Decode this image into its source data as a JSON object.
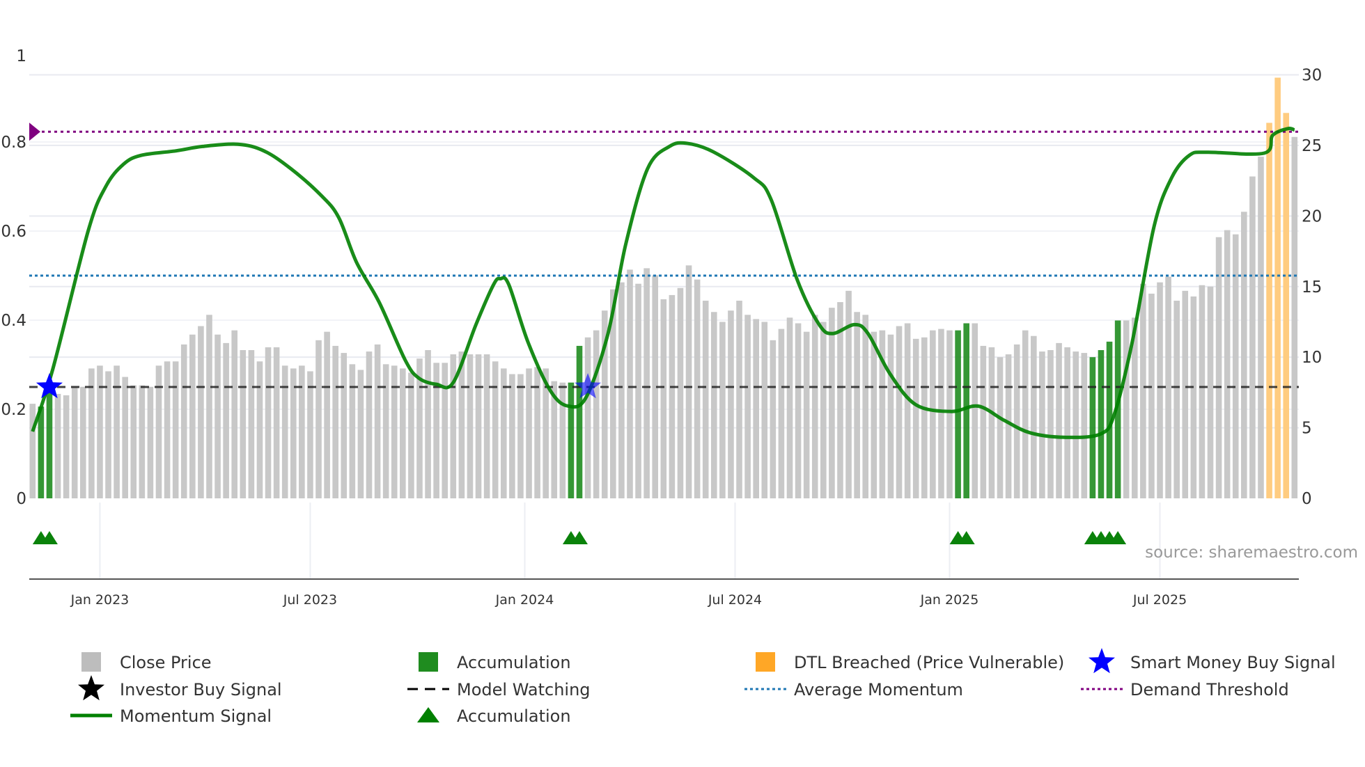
{
  "chart_data": {
    "type": "bar+line",
    "title": "",
    "left_axis": {
      "ticks": [
        "0",
        "0.2",
        "0.4",
        "0.6",
        "0.8",
        "1"
      ],
      "values": [
        0,
        0.2,
        0.4,
        0.6,
        0.8,
        1
      ],
      "range": [
        0,
        1
      ]
    },
    "right_axis": {
      "ticks": [
        "0",
        "5",
        "10",
        "15",
        "20",
        "25",
        "30"
      ],
      "values": [
        0,
        5,
        10,
        15,
        20,
        25,
        30
      ],
      "range": [
        0,
        30
      ]
    },
    "x_ticks": {
      "labels": [
        "Jan 2023",
        "Jul 2023",
        "Jan 2024",
        "Jul 2024",
        "Jan 2025",
        "Jul 2025"
      ],
      "week_index": [
        8,
        33,
        58.5,
        83.5,
        109,
        134
      ]
    },
    "close_price": [
      6.7,
      6.5,
      7.9,
      7.4,
      7.3,
      7.9,
      7.9,
      9.2,
      9.4,
      9.0,
      9.4,
      8.6,
      8.0,
      8.0,
      7.9,
      9.4,
      9.7,
      9.7,
      10.9,
      11.6,
      12.2,
      13.0,
      11.6,
      11.0,
      11.9,
      10.5,
      10.5,
      9.7,
      10.7,
      10.7,
      9.4,
      9.2,
      9.4,
      9.0,
      11.2,
      11.8,
      10.8,
      10.3,
      9.5,
      9.1,
      10.4,
      10.9,
      9.5,
      9.4,
      9.2,
      8.9,
      9.9,
      10.5,
      9.6,
      9.6,
      10.2,
      10.4,
      10.2,
      10.2,
      10.2,
      9.7,
      9.2,
      8.8,
      8.8,
      9.2,
      9.3,
      9.2,
      8.3,
      8.2,
      8.2,
      10.8,
      11.4,
      11.9,
      13.3,
      14.8,
      15.3,
      16.2,
      15.2,
      16.3,
      15.8,
      14.1,
      14.4,
      14.9,
      16.5,
      15.5,
      14.0,
      13.2,
      12.5,
      13.3,
      14.0,
      13.0,
      12.7,
      12.5,
      11.2,
      12.0,
      12.8,
      12.4,
      11.8,
      13.0,
      12.5,
      13.5,
      13.9,
      14.7,
      13.2,
      13.0,
      11.8,
      11.9,
      11.6,
      12.2,
      12.4,
      11.3,
      11.4,
      11.9,
      12.0,
      11.9,
      11.9,
      12.4,
      12.4,
      10.8,
      10.7,
      10.0,
      10.2,
      10.9,
      11.9,
      11.5,
      10.4,
      10.5,
      11.0,
      10.7,
      10.4,
      10.3,
      10.0,
      10.5,
      11.1,
      12.6,
      12.6,
      12.8,
      15.2,
      14.5,
      15.3,
      15.7,
      14.0,
      14.7,
      14.3,
      15.1,
      15.0,
      18.5,
      19.0,
      18.7,
      20.3,
      22.8,
      24.2,
      26.6,
      29.8,
      27.3,
      25.6
    ],
    "accumulation_bars": [
      1,
      2,
      64,
      65,
      110,
      111,
      126,
      127,
      128,
      129
    ],
    "dtl_breached_bars": [
      147,
      148,
      149
    ],
    "accumulation_triangles": [
      1,
      2,
      64,
      65,
      110,
      111,
      126,
      127,
      128,
      129
    ],
    "smart_money_buy_signals": [
      {
        "week_index": 2,
        "value": 0.25
      },
      {
        "week_index": 66,
        "value": 0.25
      }
    ],
    "momentum_signal": [
      [
        0,
        0.15
      ],
      [
        2.4,
        0.29
      ],
      [
        6.6,
        0.6
      ],
      [
        8.7,
        0.7
      ],
      [
        10.8,
        0.75
      ],
      [
        12.9,
        0.77
      ],
      [
        17,
        0.78
      ],
      [
        20.2,
        0.79
      ],
      [
        24.4,
        0.795
      ],
      [
        27.5,
        0.78
      ],
      [
        30.7,
        0.74
      ],
      [
        34.3,
        0.68
      ],
      [
        36.4,
        0.63
      ],
      [
        38.5,
        0.53
      ],
      [
        41.2,
        0.44
      ],
      [
        44.3,
        0.31
      ],
      [
        45.9,
        0.27
      ],
      [
        48,
        0.256
      ],
      [
        50,
        0.26
      ],
      [
        52.7,
        0.39
      ],
      [
        54.8,
        0.48
      ],
      [
        55.6,
        0.493
      ],
      [
        56.6,
        0.48
      ],
      [
        58.9,
        0.35
      ],
      [
        61.6,
        0.24
      ],
      [
        63.7,
        0.207
      ],
      [
        65.8,
        0.227
      ],
      [
        68.4,
        0.37
      ],
      [
        70.5,
        0.57
      ],
      [
        73.1,
        0.74
      ],
      [
        75.7,
        0.79
      ],
      [
        77.8,
        0.797
      ],
      [
        80.9,
        0.778
      ],
      [
        85.7,
        0.72
      ],
      [
        87.8,
        0.67
      ],
      [
        90.9,
        0.49
      ],
      [
        93.5,
        0.39
      ],
      [
        95.1,
        0.37
      ],
      [
        97.7,
        0.39
      ],
      [
        99.3,
        0.37
      ],
      [
        101.9,
        0.28
      ],
      [
        105,
        0.21
      ],
      [
        109.2,
        0.195
      ],
      [
        112.4,
        0.207
      ],
      [
        115.5,
        0.175
      ],
      [
        118.6,
        0.147
      ],
      [
        122.8,
        0.137
      ],
      [
        127,
        0.145
      ],
      [
        128.6,
        0.19
      ],
      [
        130.7,
        0.35
      ],
      [
        133.3,
        0.61
      ],
      [
        135.4,
        0.72
      ],
      [
        137.5,
        0.77
      ],
      [
        139.6,
        0.777
      ],
      [
        146.4,
        0.775
      ],
      [
        147.4,
        0.815
      ],
      [
        149.2,
        0.83
      ],
      [
        150,
        0.827
      ]
    ],
    "model_watching": 0.25,
    "average_momentum": 0.5,
    "demand_threshold": 0.823,
    "legend": [
      {
        "label": "Close Price",
        "marker": "square",
        "color": "#bdbdbd"
      },
      {
        "label": "Accumulation",
        "marker": "square",
        "color": "#1f8c1f"
      },
      {
        "label": "DTL Breached (Price Vulnerable)",
        "marker": "square",
        "color": "#ffa726"
      },
      {
        "label": "Smart Money Buy Signal",
        "marker": "star",
        "color": "#0000ff"
      },
      {
        "label": "Investor Buy Signal",
        "marker": "star",
        "color": "#000000"
      },
      {
        "label": "Model Watching",
        "marker": "dash",
        "color": "#000000"
      },
      {
        "label": "Average Momentum",
        "marker": "dot",
        "color": "#1f77b4"
      },
      {
        "label": "Demand Threshold",
        "marker": "dot",
        "color": "#800080"
      },
      {
        "label": "Momentum Signal",
        "marker": "line",
        "color": "#008000"
      },
      {
        "label": "Accumulation",
        "marker": "triangle",
        "color": "#008000"
      }
    ],
    "legend_placement": "bottom",
    "grid": true
  },
  "source": "source: sharemaestro.com"
}
